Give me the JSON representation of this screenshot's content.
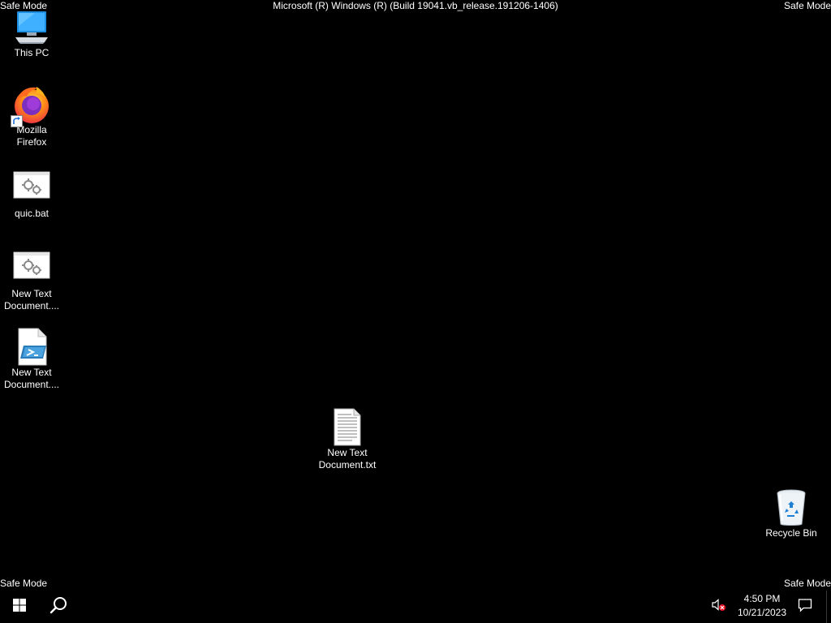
{
  "watermark": {
    "top_left": "Safe Mode",
    "top_center": "Microsoft (R) Windows (R) (Build 19041.vb_release.191206-1406)",
    "top_right": "Safe Mode",
    "bottom_left": "Safe Mode",
    "bottom_right": "Safe Mode"
  },
  "desktop_icons": [
    {
      "label": "This PC",
      "icon": "this-pc-icon"
    },
    {
      "label": "Mozilla Firefox",
      "icon": "firefox-icon",
      "shortcut": true
    },
    {
      "label": "quic.bat",
      "icon": "batch-file-icon"
    },
    {
      "label": "New Text Document....",
      "icon": "batch-file-icon"
    },
    {
      "label": "New Text Document....",
      "icon": "powershell-script-icon"
    },
    {
      "label": "New Text Document.txt",
      "icon": "text-file-icon"
    },
    {
      "label": "Recycle Bin",
      "icon": "recycle-bin-icon"
    }
  ],
  "taskbar": {
    "start_icon": "windows-logo-icon",
    "search_icon": "search-icon",
    "volume_icon": "volume-muted-icon",
    "notification_icon": "action-center-icon",
    "time": "4:50 PM",
    "date": "10/21/2023"
  },
  "colors": {
    "background": "#000000",
    "text": "#ffffff",
    "firefox_orange": "#ff9500",
    "firefox_purple": "#7b2fbe",
    "muted_red": "#e81123"
  }
}
